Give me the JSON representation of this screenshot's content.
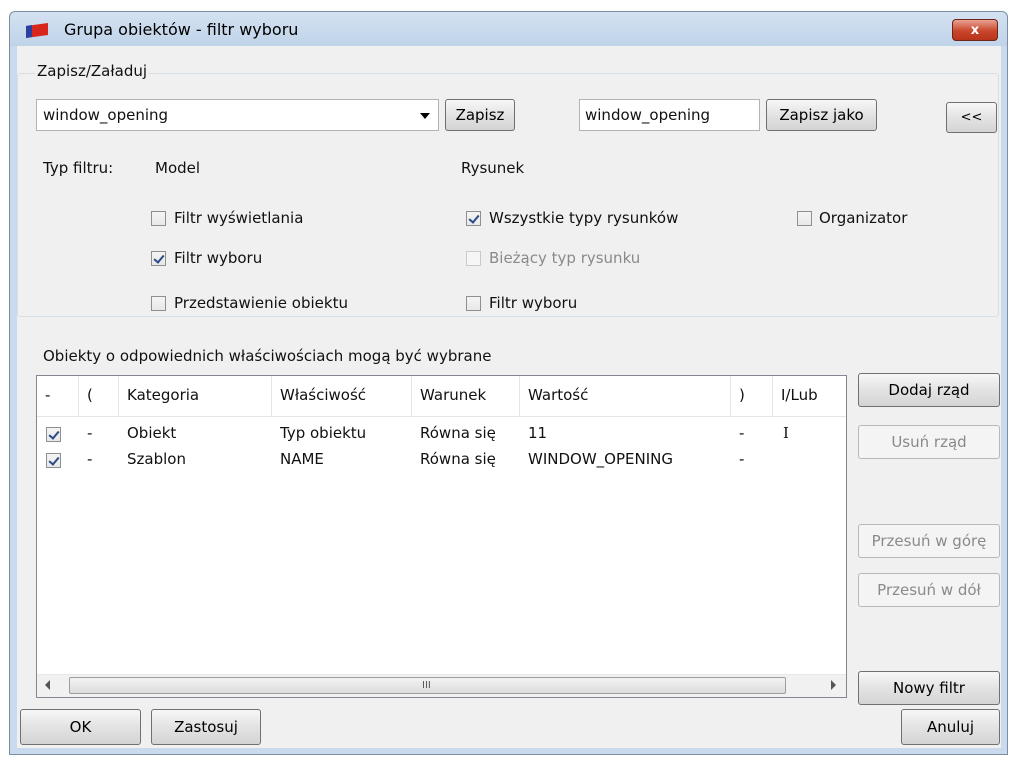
{
  "window": {
    "title": "Grupa obiektów - filtr wyboru",
    "close_label": "x"
  },
  "save_load": {
    "group_label": "Zapisz/Załaduj",
    "filter_select_value": "window_opening",
    "save_label": "Zapisz",
    "save_as_name": "window_opening",
    "save_as_label": "Zapisz jako",
    "collapse_label": "<<"
  },
  "filter_type": {
    "label": "Typ filtru:",
    "model_label": "Model",
    "drawing_label": "Rysunek",
    "options": {
      "display_filter": {
        "label": "Filtr wyświetlania",
        "checked": false,
        "enabled": true
      },
      "model_selection_filter": {
        "label": "Filtr wyboru",
        "checked": true,
        "enabled": true
      },
      "object_representation": {
        "label": "Przedstawienie obiektu",
        "checked": false,
        "enabled": true
      },
      "all_drawing_types": {
        "label": "Wszystkie typy rysunków",
        "checked": true,
        "enabled": true
      },
      "current_drawing_type": {
        "label": "Bieżący typ rysunku",
        "checked": false,
        "enabled": false
      },
      "drawing_selection_filter": {
        "label": "Filtr wyboru",
        "checked": false,
        "enabled": true
      },
      "organizer": {
        "label": "Organizator",
        "checked": false,
        "enabled": true
      }
    }
  },
  "rules": {
    "caption": "Obiekty o odpowiednich właściwościach mogą być wybrane",
    "columns": [
      "-",
      "(",
      "Kategoria",
      "Właściwość",
      "Warunek",
      "Wartość",
      ")",
      "I/Lub"
    ],
    "rows": [
      {
        "checked": true,
        "open": "-",
        "category": "Obiekt",
        "property": "Typ obiektu",
        "condition": "Równa się",
        "value": "11",
        "close": "-",
        "andor": "I"
      },
      {
        "checked": true,
        "open": "-",
        "category": "Szablon",
        "property": "NAME",
        "condition": "Równa się",
        "value": "WINDOW_OPENING",
        "close": "-",
        "andor": ""
      }
    ],
    "scroll_grip": "III"
  },
  "side_buttons": {
    "add_row": "Dodaj rząd",
    "remove_row": "Usuń rząd",
    "move_up": "Przesuń w górę",
    "move_down": "Przesuń w dół",
    "new_filter": "Nowy filtr"
  },
  "footer": {
    "ok": "OK",
    "apply": "Zastosuj",
    "cancel": "Anuluj"
  }
}
